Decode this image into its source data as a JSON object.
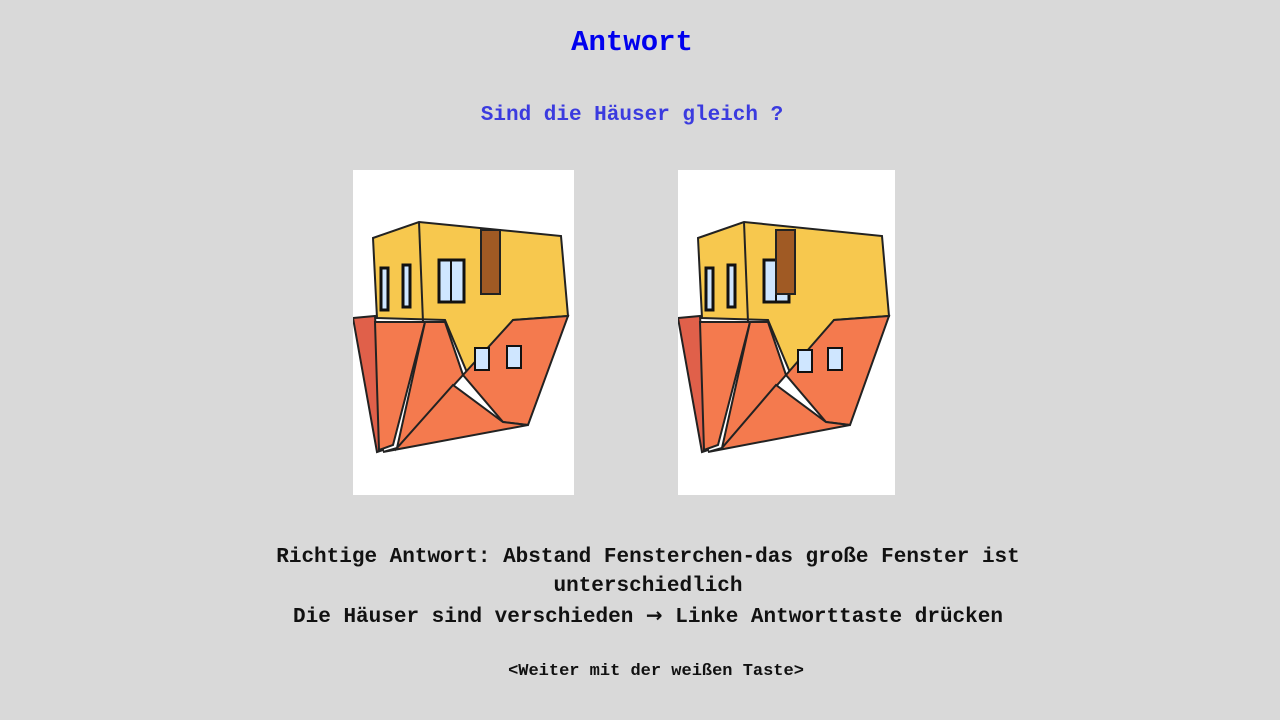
{
  "header": {
    "title": "Antwort",
    "question": "Sind die Häuser gleich ?"
  },
  "stimuli": {
    "left_image_icon": "upside-down-house-icon",
    "right_image_icon": "upside-down-house-icon"
  },
  "feedback": {
    "line1": "Richtige Antwort: Abstand Fensterchen-das große Fenster ist",
    "line2": "unterschiedlich",
    "line3_before_arrow": "Die Häuser sind verschieden",
    "arrow": "→",
    "line3_after_arrow": "Linke Antworttaste drücken"
  },
  "footer": {
    "continue_hint": "<Weiter mit der weißen Taste>"
  },
  "colors": {
    "background": "#d9d9d9",
    "title": "#0000ee",
    "question": "#3b3bdf",
    "wall": "#f7c84e",
    "roof": "#f47a4e"
  }
}
